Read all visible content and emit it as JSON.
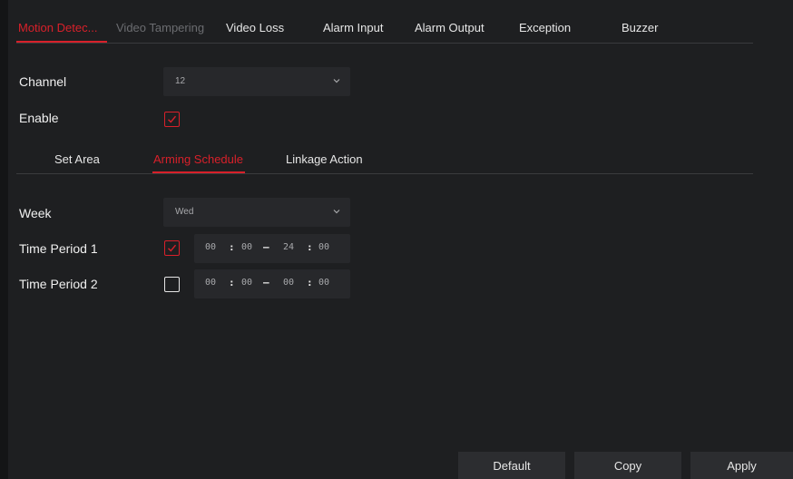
{
  "top_tabs": [
    {
      "label": "Motion Detec...",
      "state": "active"
    },
    {
      "label": "Video Tampering",
      "state": "disabled"
    },
    {
      "label": "Video Loss",
      "state": "normal"
    },
    {
      "label": "Alarm Input",
      "state": "normal"
    },
    {
      "label": "Alarm Output",
      "state": "normal"
    },
    {
      "label": "Exception",
      "state": "normal"
    },
    {
      "label": "Buzzer",
      "state": "normal"
    }
  ],
  "channel": {
    "label": "Channel",
    "value": "12"
  },
  "enable": {
    "label": "Enable",
    "checked": true
  },
  "sub_tabs": [
    {
      "label": "Set Area",
      "state": "normal"
    },
    {
      "label": "Arming Schedule",
      "state": "active"
    },
    {
      "label": "Linkage Action",
      "state": "normal"
    }
  ],
  "week": {
    "label": "Week",
    "value": "Wed"
  },
  "periods": [
    {
      "label": "Time Period 1",
      "checked": true,
      "start_h": "00",
      "start_m": "00",
      "end_h": "24",
      "end_m": "00"
    },
    {
      "label": "Time Period 2",
      "checked": false,
      "start_h": "00",
      "start_m": "00",
      "end_h": "00",
      "end_m": "00"
    }
  ],
  "time_separators": {
    "colon": ":",
    "dash": "–"
  },
  "buttons": {
    "default": "Default",
    "copy": "Copy",
    "apply": "Apply"
  },
  "colors": {
    "accent": "#d8202a",
    "background": "#1e1f21",
    "field": "#27282b"
  }
}
